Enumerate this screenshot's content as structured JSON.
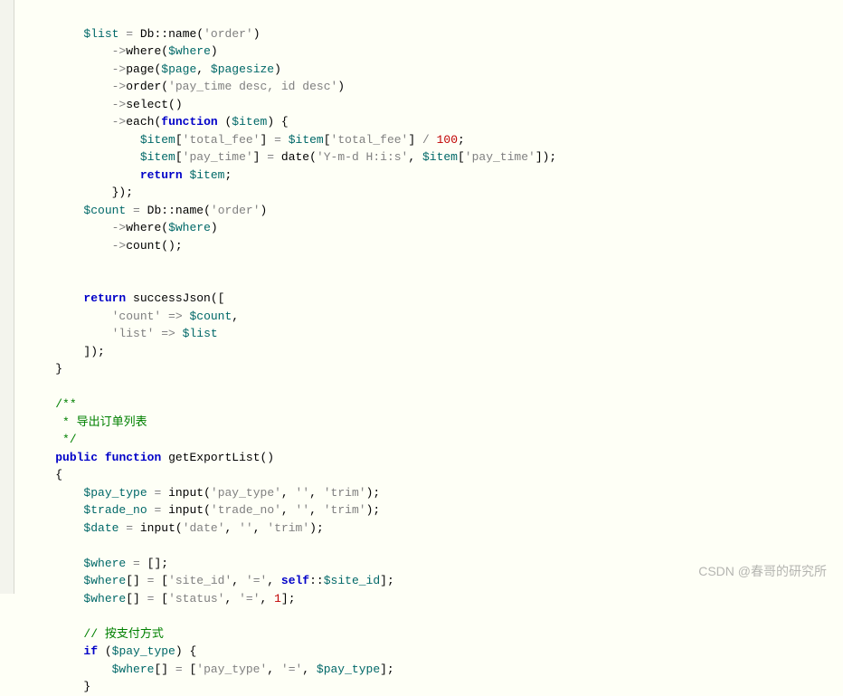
{
  "code": {
    "l1": {
      "var1": "$list",
      "cls": "Db",
      "method": "name",
      "str": "'order'"
    },
    "l2": {
      "arrow": "->",
      "method": "where",
      "var": "$where"
    },
    "l3": {
      "arrow": "->",
      "method": "page",
      "var1": "$page",
      "var2": "$pagesize"
    },
    "l4": {
      "arrow": "->",
      "method": "order",
      "str": "'pay_time desc, id desc'"
    },
    "l5": {
      "arrow": "->",
      "method": "select"
    },
    "l6": {
      "arrow": "->",
      "method": "each",
      "kw": "function",
      "var": "$item"
    },
    "l7": {
      "var": "$item",
      "key1": "'total_fee'",
      "var2": "$item",
      "key2": "'total_fee'",
      "num": "100"
    },
    "l8": {
      "var": "$item",
      "key1": "'pay_time'",
      "func": "date",
      "str": "'Y-m-d H:i:s'",
      "var2": "$item",
      "key2": "'pay_time'"
    },
    "l9": {
      "kw": "return",
      "var": "$item"
    },
    "l10": {
      "close": "});"
    },
    "l11": {
      "var": "$count",
      "cls": "Db",
      "method": "name",
      "str": "'order'"
    },
    "l12": {
      "arrow": "->",
      "method": "where",
      "var": "$where"
    },
    "l13": {
      "arrow": "->",
      "method": "count"
    },
    "l14": "",
    "l15": "",
    "l16": {
      "kw": "return",
      "func": "successJson"
    },
    "l17": {
      "key": "'count'",
      "arrow": "=>",
      "var": "$count"
    },
    "l18": {
      "key": "'list'",
      "arrow": "=>",
      "var": "$list"
    },
    "l19": {
      "close": "]);"
    },
    "l20": {
      "brace": "}"
    },
    "l21": "",
    "l22": {
      "c": "/**"
    },
    "l23": {
      "c": " * 导出订单列表"
    },
    "l24": {
      "c": " */"
    },
    "l25": {
      "kw1": "public",
      "kw2": "function",
      "name": "getExportList"
    },
    "l26": {
      "brace": "{"
    },
    "l27": {
      "var": "$pay_type",
      "func": "input",
      "str1": "'pay_type'",
      "str2": "''",
      "str3": "'trim'"
    },
    "l28": {
      "var": "$trade_no",
      "func": "input",
      "str1": "'trade_no'",
      "str2": "''",
      "str3": "'trim'"
    },
    "l29": {
      "var": "$date",
      "func": "input",
      "str1": "'date'",
      "str2": "''",
      "str3": "'trim'"
    },
    "l30": "",
    "l31": {
      "var": "$where"
    },
    "l32": {
      "var": "$where",
      "str1": "'site_id'",
      "str2": "'='",
      "kw": "self",
      "var2": "$site_id"
    },
    "l33": {
      "var": "$where",
      "str1": "'status'",
      "str2": "'='",
      "num": "1"
    },
    "l34": "",
    "l35": {
      "c": "// 按支付方式"
    },
    "l36": {
      "kw": "if",
      "var": "$pay_type"
    },
    "l37": {
      "var": "$where",
      "str1": "'pay_type'",
      "str2": "'='",
      "var2": "$pay_type"
    },
    "l38": {
      "brace": "}"
    }
  },
  "watermark": "CSDN @春哥的研究所"
}
